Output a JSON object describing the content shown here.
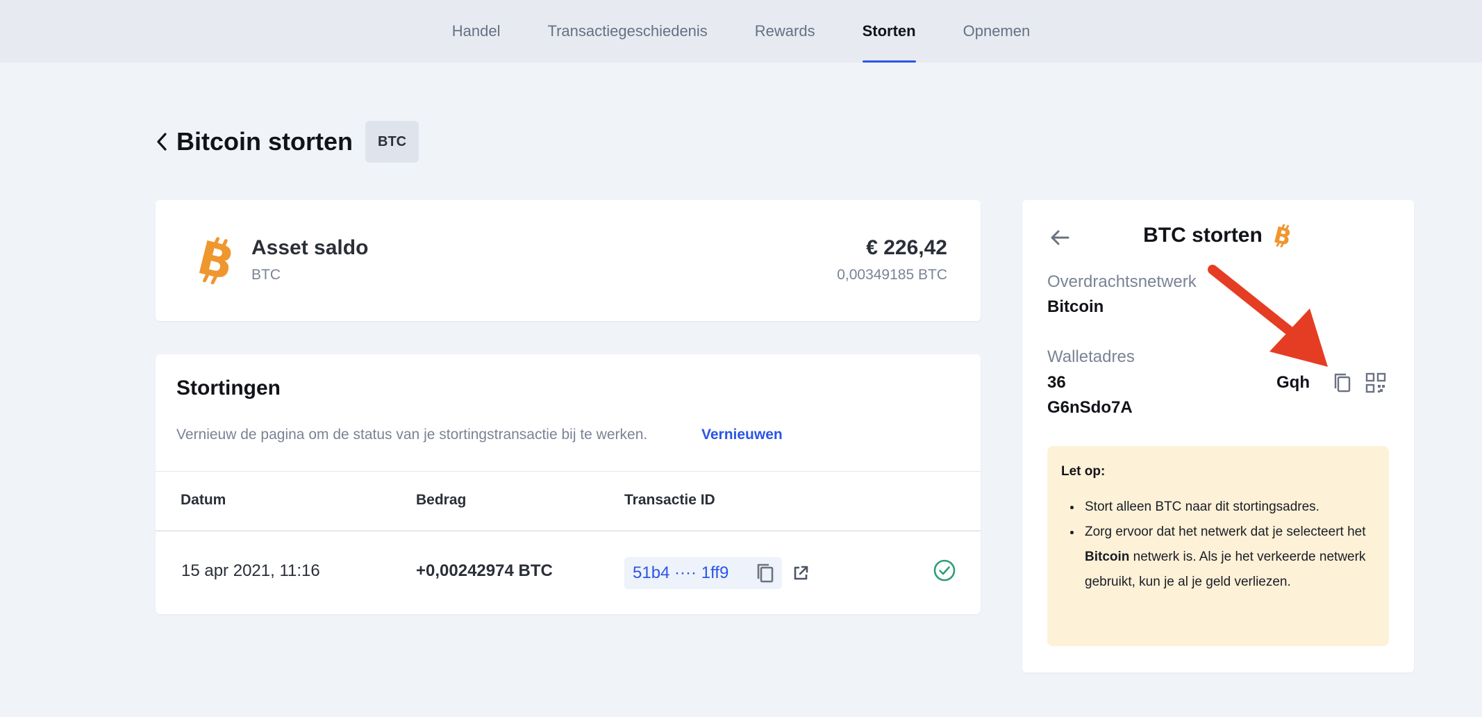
{
  "topnav": {
    "tabs": [
      {
        "label": "Handel",
        "active": false
      },
      {
        "label": "Transactiegeschiedenis",
        "active": false
      },
      {
        "label": "Rewards",
        "active": false
      },
      {
        "label": "Storten",
        "active": true
      },
      {
        "label": "Opnemen",
        "active": false
      }
    ]
  },
  "header": {
    "title": "Bitcoin storten",
    "badge": "BTC"
  },
  "asset": {
    "name": "Asset saldo",
    "symbol": "BTC",
    "fiat_value": "€ 226,42",
    "crypto_value": "0,00349185 BTC"
  },
  "deposits": {
    "title": "Stortingen",
    "hint": "Vernieuw de pagina om de status van je stortingstransactie bij te werken.",
    "refresh_label": "Vernieuwen",
    "columns": [
      "Datum",
      "Bedrag",
      "Transactie ID"
    ],
    "rows": [
      {
        "date": "15 apr 2021, 11:16",
        "amount": "+0,00242974 BTC",
        "txid": "51b4 ···· 1ff9",
        "status": "completed"
      }
    ]
  },
  "side": {
    "title": "BTC storten",
    "network_label": "Overdrachtsnetwerk",
    "network_value": "Bitcoin",
    "wallet_label": "Walletadres",
    "wallet_line1_start": "36",
    "wallet_line1_end": "Gqh",
    "wallet_line2": "G6nSdo7A",
    "notice": {
      "title": "Let op:",
      "item1": "Stort alleen BTC naar dit stortingsadres.",
      "item2_pre": "Zorg ervoor dat het netwerk dat je selecteert het ",
      "item2_bold": "Bitcoin",
      "item2_post": " netwerk is. Als je het verkeerde netwerk gebruikt, kun je al je geld verliezen."
    }
  },
  "colors": {
    "accent": "#2b55e6",
    "bitcoin": "#f0962f",
    "success": "#2e9e78",
    "annotation": "#e53d24",
    "notice_bg": "#fdf1d8"
  }
}
